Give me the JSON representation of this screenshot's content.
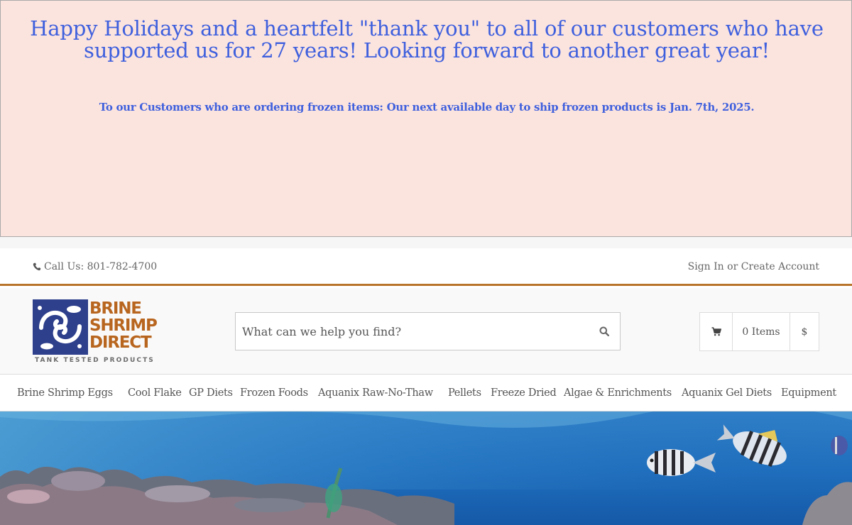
{
  "banner": {
    "headline": "Happy Holidays and a heartfelt \"thank you\" to all of our customers who have supported us for 27 years! Looking forward to another great year!",
    "notice": "To our Customers who are ordering frozen items: Our next available day to ship frozen products is Jan. 7th, 2025."
  },
  "topbar": {
    "call_label": "Call Us: 801-782-4700",
    "sign_in": "Sign In",
    "or": "or",
    "create_account": "Create Account"
  },
  "logo": {
    "line1": "BRINE",
    "line2": "SHRIMP",
    "line3": "DIRECT",
    "tagline": "TANK TESTED PRODUCTS"
  },
  "search": {
    "placeholder": "What can we help you find?",
    "icon": "search-icon"
  },
  "cart": {
    "icon": "cart-icon",
    "items_label": "0 Items",
    "currency": "$"
  },
  "nav": {
    "items": [
      {
        "label": "Brine Shrimp Eggs"
      },
      {
        "label": "Cool Flake"
      },
      {
        "label": "GP Diets"
      },
      {
        "label": "Frozen Foods"
      },
      {
        "label": "Aquanix Raw-No-Thaw"
      },
      {
        "label": "Pellets"
      },
      {
        "label": "Freeze Dried"
      },
      {
        "label": "Algae & Enrichments"
      },
      {
        "label": "Aquanix Gel Diets"
      },
      {
        "label": "Equipment"
      }
    ]
  },
  "colors": {
    "banner_bg": "#fce4de",
    "banner_text": "#3f60dd",
    "accent_rule": "#b8742a",
    "logo_blue": "#2e3f8c",
    "logo_orange": "#b8661f"
  }
}
